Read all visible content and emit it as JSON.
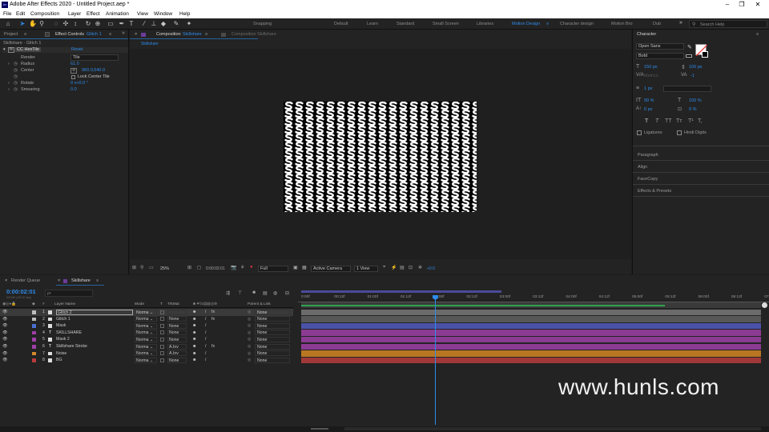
{
  "app": {
    "title": "Adobe After Effects 2020 - Untitled Project.aep *",
    "icon_text": "Ae"
  },
  "window_controls": {
    "minimize": "–",
    "maximize": "❐",
    "close": "✕"
  },
  "menu": [
    "File",
    "Edit",
    "Composition",
    "Layer",
    "Effect",
    "Animation",
    "View",
    "Window",
    "Help"
  ],
  "toolbar": {
    "snapping_label": "Snapping",
    "workspaces": [
      "Default",
      "Learn",
      "Standard",
      "Small Screen",
      "Libraries",
      "Motion Design",
      "Character design",
      "Motion Bro",
      "Dub"
    ],
    "active_workspace": "Motion Design",
    "more": "»",
    "search_placeholder": "Search Help"
  },
  "project_panel": {
    "tab_project": "Project",
    "tab_effect_controls": "Effect Controls",
    "effect_layer": "Glitch 1",
    "menu": "≡",
    "expand": "»",
    "breadcrumb": "Skillshare · Glitch 1",
    "effect": {
      "fx": "fx",
      "name": "CC HexTile",
      "reset": "Reset",
      "props": [
        {
          "label": "Render",
          "value": "Tile",
          "type": "dropdown"
        },
        {
          "label": "Radius",
          "value": "61.0"
        },
        {
          "label": "Center",
          "value": "960.0,540.0"
        },
        {
          "label": "",
          "value": "Lock Center Tile",
          "type": "checkbox"
        },
        {
          "label": "Rotate",
          "value": "0 x+0.0 °"
        },
        {
          "label": "Smearing",
          "value": "0.0"
        }
      ]
    }
  },
  "composition_panel": {
    "tab_name": "Composition",
    "comp_name": "Skillshare",
    "menu": "≡",
    "second_tab": "Composition Skillshare",
    "comp_flow_label": "Skillshare",
    "footer": {
      "zoom": "25%",
      "timecode": "0:00:02:01",
      "resolution": "Full",
      "camera": "Active Camera",
      "views": "1 View",
      "exposure": "+0.0"
    }
  },
  "character_panel": {
    "title": "Character",
    "menu": "≡",
    "font": "Open Sans",
    "style": "Bold",
    "size": "150 px",
    "leading": "100 px",
    "kerning": "Metrics",
    "tracking": "-1",
    "stroke_width": "1 px",
    "vscale": "99 %",
    "hscale": "100 %",
    "baseline": "0 px",
    "tsume": "0 %",
    "type_buttons": [
      "T",
      "T",
      "TT",
      "Tт",
      "T¹",
      "T,"
    ],
    "ligatures": "Ligatures",
    "hindi_digits": "Hindi Digits",
    "sections": [
      "Paragraph",
      "Align",
      "FaceCopy",
      "Effects & Presets"
    ]
  },
  "timeline": {
    "tab_render": "Render Queue",
    "tab_comp": "Skillshare",
    "menu": "≡",
    "timecode": "0:00:02:01",
    "frames": "00049 (25.00 fps)",
    "search_placeholder": "ρ•",
    "headers": {
      "layer_name": "Layer Name",
      "mode": "Mode",
      "trkmat": "TrkMat",
      "parent": "Parent & Link"
    },
    "ruler": [
      "0:00f",
      "00:12f",
      "01:00f",
      "01:12f",
      "02:00f",
      "02:12f",
      "03:00f",
      "03:12f",
      "04:00f",
      "04:12f",
      "05:00f",
      "05:12f",
      "06:00f",
      "06:12f",
      "07:0"
    ],
    "layers": [
      {
        "num": "1",
        "type": "sq",
        "name": "Glitch 2",
        "mode": "Norma",
        "trkmat": "",
        "parent": "None",
        "color": "#bdbdbd",
        "has_fx": true,
        "bar_color": "#6b6b6b"
      },
      {
        "num": "2",
        "type": "sq",
        "name": "Glitch 1",
        "mode": "Norma",
        "trkmat": "None",
        "parent": "None",
        "color": "#bdbdbd",
        "has_fx": true,
        "bar_color": "#575757"
      },
      {
        "num": "3",
        "type": "sq",
        "name": "Mask",
        "mode": "Norma",
        "trkmat": "None",
        "parent": "None",
        "color": "#4a6fd1",
        "has_fx": false,
        "bar_color": "#4a52a8"
      },
      {
        "num": "4",
        "type": "T",
        "name": "SKILLSHARE",
        "mode": "Norma",
        "trkmat": "None",
        "parent": "None",
        "color": "#a13ea8",
        "has_fx": false,
        "bar_color": "#8c3b93"
      },
      {
        "num": "5",
        "type": "sq",
        "name": "Mask 2",
        "mode": "Norma",
        "trkmat": "None",
        "parent": "None",
        "color": "#a13ea8",
        "has_fx": false,
        "bar_color": "#8c3b93"
      },
      {
        "num": "6",
        "type": "T",
        "name": "Skillshare Stroke",
        "mode": "Norma",
        "trkmat": "A.Inv",
        "parent": "None",
        "color": "#a13ea8",
        "has_fx": true,
        "bar_color": "#8c3b93"
      },
      {
        "num": "7",
        "type": "sq",
        "name": "Noise",
        "mode": "Norma",
        "trkmat": "A.Inv",
        "parent": "None",
        "color": "#d3882c",
        "has_fx": false,
        "bar_color": "#b97622"
      },
      {
        "num": "8",
        "type": "sq",
        "name": "BG",
        "mode": "Norma",
        "trkmat": "None",
        "parent": "None",
        "color": "#b83b3b",
        "has_fx": false,
        "bar_color": "#a03838"
      }
    ]
  },
  "watermark": "www.hunls.com",
  "colors": {
    "accent": "#2d8ceb",
    "panel_bg": "#232323",
    "dark_bg": "#1d1d1d"
  }
}
